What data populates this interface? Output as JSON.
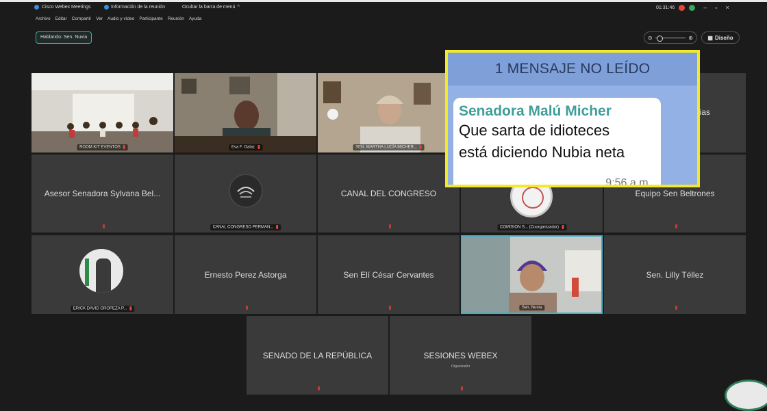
{
  "titlebar": {
    "app_name": "Cisco Webex Meetings",
    "meeting_info": "Información de la reunión",
    "hide_menu": "Ocultar la barra de menú",
    "clock": "01:31:46"
  },
  "menu": [
    "Archivo",
    "Editar",
    "Compartir",
    "Ver",
    "Audio y vídeo",
    "Participante",
    "Reunión",
    "Ayuda"
  ],
  "speaking": "Hablando: Sen. Nuvia",
  "layout_label": "Diseño",
  "tiles": {
    "room_kit": "ROOM KIT EVENTOS",
    "eva": "Eva F. Galaz",
    "martha": "SEN. MARTHA LUCÍA MICHER...",
    "asesor": "Asesor Senadora Sylvana Bel...",
    "canal_permanente": "CANAL CONGRESO PERMAN...",
    "canal_congreso": "CANAL DEL CONGRESO",
    "comision": "COMISION S... (Coorganizador)",
    "equipo": "Equipo Sen Beltrones",
    "erick": "ERICK DAVID OROPEZA P...",
    "ernesto": "Ernesto Perez Astorga",
    "eli": "Sen Elí César Cervantes",
    "nuvia": "Sen. Nuvia",
    "lilly": "Sen. Lilly Téllez",
    "senado": "SENADO DE LA REPÚBLICA",
    "sesiones": "SESIONES WEBEX",
    "sesiones_sub": "Organizador",
    "top_right_partial": "ias"
  },
  "popup": {
    "header": "1 MENSAJE NO LEÍDO",
    "sender": "Senadora Malú Micher",
    "line1": "Que sarta de idioteces",
    "line2": "está diciendo Nubia neta",
    "time": "9:56 a.m."
  }
}
